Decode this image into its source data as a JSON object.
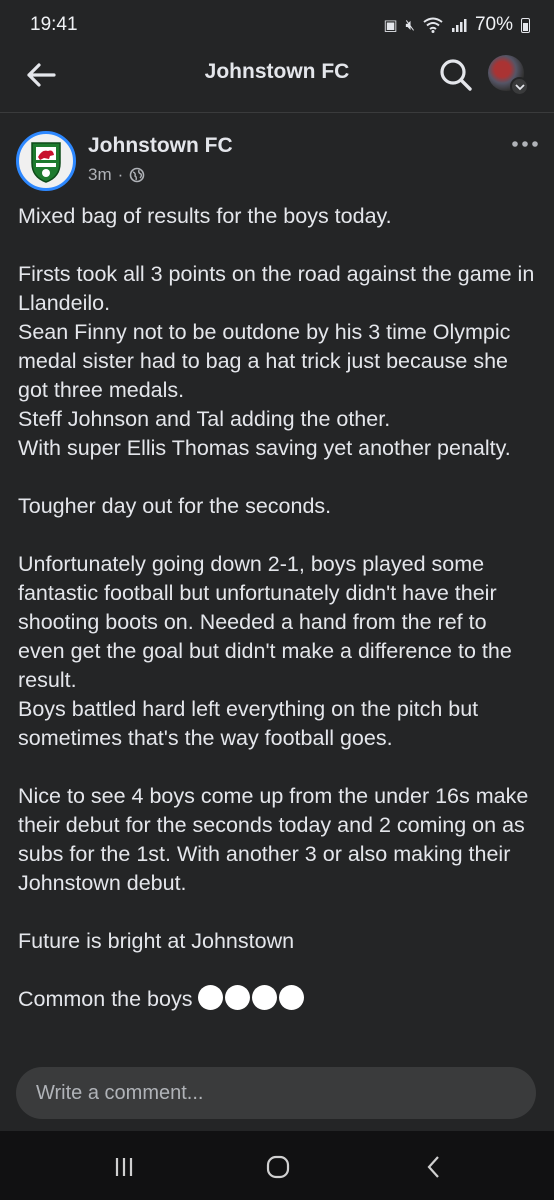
{
  "status_bar": {
    "time": "19:41",
    "battery": "70%"
  },
  "header": {
    "title": "Johnstown FC"
  },
  "post": {
    "author": "Johnstown FC",
    "time": "3m",
    "separator": "·",
    "body": [
      "Mixed bag of results for the boys today.",
      "",
      "Firsts took all 3 points on the road against the game in Llandeilo.",
      "Sean Finny not to be outdone by his 3 time Olympic medal sister had to bag a hat trick just because she got three medals.",
      "Steff Johnson and Tal adding the other.",
      "With super Ellis Thomas saving yet another penalty.",
      "",
      "Tougher day out for the seconds.",
      "",
      "Unfortunately going down 2-1, boys played some fantastic football but unfortunately didn't have their shooting boots on. Needed a hand from the ref to even get the goal but didn't make a difference to the result.",
      "Boys battled hard left everything on the pitch but sometimes that's the way football goes.",
      "",
      "Nice to see 4 boys come up from the under 16s make their debut for the seconds today and 2 coming on as subs for the 1st. With another 3 or also making their Johnstown debut.",
      "",
      "Future is bright at Johnstown",
      "",
      "Common the boys"
    ],
    "emoji_count": 4
  },
  "comment": {
    "placeholder": "Write a comment..."
  },
  "colors": {
    "background": "#242526",
    "accent": "#2d88ff",
    "text": "#e4e6eb",
    "muted": "#b0b3b8"
  },
  "icons": [
    "back-arrow-icon",
    "search-icon",
    "more-options-icon",
    "globe-icon",
    "recent-apps-icon",
    "home-icon",
    "back-icon"
  ]
}
